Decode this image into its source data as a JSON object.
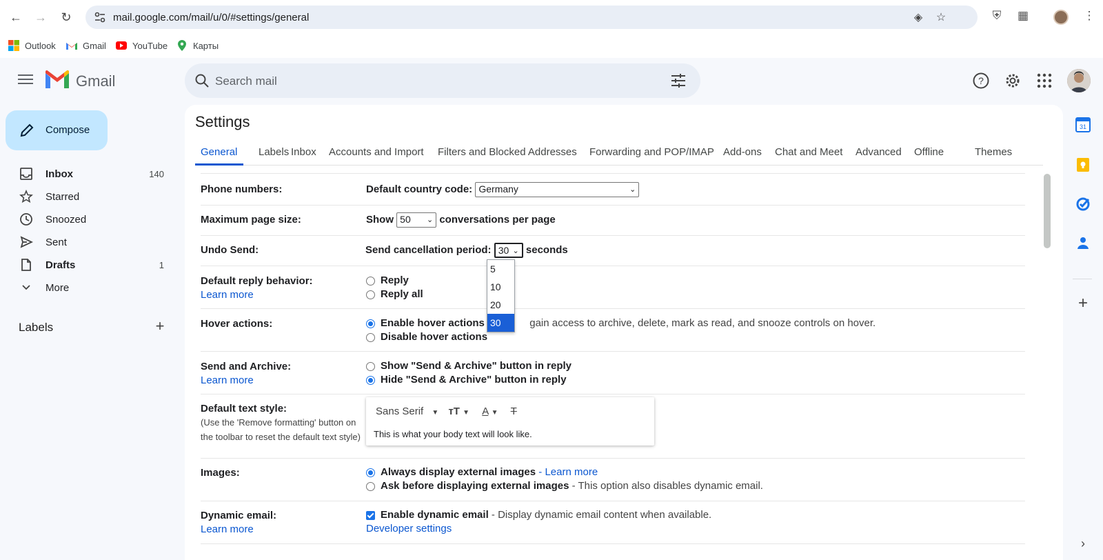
{
  "browser": {
    "url": "mail.google.com/mail/u/0/#settings/general",
    "bookmarks": [
      {
        "label": "Outlook"
      },
      {
        "label": "Gmail"
      },
      {
        "label": "YouTube"
      },
      {
        "label": "Карты"
      }
    ]
  },
  "header": {
    "app_name": "Gmail",
    "search_placeholder": "Search mail"
  },
  "nav": {
    "compose_label": "Compose",
    "items": [
      {
        "label": "Inbox",
        "count": "140",
        "icon": "inbox-icon"
      },
      {
        "label": "Starred",
        "count": "",
        "icon": "star-icon"
      },
      {
        "label": "Snoozed",
        "count": "",
        "icon": "clock-icon"
      },
      {
        "label": "Sent",
        "count": "",
        "icon": "send-icon"
      },
      {
        "label": "Drafts",
        "count": "1",
        "icon": "draft-icon"
      },
      {
        "label": "More",
        "count": "",
        "icon": "chevron-down-icon"
      }
    ],
    "labels_header": "Labels"
  },
  "settings": {
    "title": "Settings",
    "tabs": [
      "General",
      "Labels",
      "Inbox",
      "Accounts and Import",
      "Filters and Blocked Addresses",
      "Forwarding and POP/IMAP",
      "Add-ons",
      "Chat and Meet",
      "Advanced",
      "Offline",
      "Themes"
    ],
    "active_tab": "General",
    "phone": {
      "label": "Phone numbers:",
      "prefix": "Default country code:",
      "value": "Germany"
    },
    "page_size": {
      "label": "Maximum page size:",
      "prefix": "Show",
      "value": "50",
      "suffix": "conversations per page"
    },
    "undo_send": {
      "label": "Undo Send:",
      "prefix": "Send cancellation period:",
      "value": "30",
      "suffix": "seconds",
      "options": [
        "5",
        "10",
        "20",
        "30"
      ],
      "selected": "30"
    },
    "reply": {
      "label": "Default reply behavior:",
      "learn_more": "Learn more",
      "options": [
        "Reply",
        "Reply all"
      ]
    },
    "hover": {
      "label": "Hover actions:",
      "enable": "Enable hover actions",
      "enable_desc": "gain access to archive, delete, mark as read, and snooze controls on hover.",
      "disable": "Disable hover actions"
    },
    "send_archive": {
      "label": "Send and Archive:",
      "learn_more": "Learn more",
      "show": "Show \"Send & Archive\" button in reply",
      "hide": "Hide \"Send & Archive\" button in reply"
    },
    "text_style": {
      "label": "Default text style:",
      "note_line1": "(Use the 'Remove formatting' button on",
      "note_line2": "the toolbar to reset the default text style)",
      "font": "Sans Serif",
      "sample": "This is what your body text will look like."
    },
    "images": {
      "label": "Images:",
      "always": "Always display external images",
      "always_link": "Learn more",
      "ask": "Ask before displaying external images",
      "ask_desc": "- This option also disables dynamic email."
    },
    "dynamic": {
      "label": "Dynamic email:",
      "learn_more": "Learn more",
      "enable": "Enable dynamic email",
      "enable_desc": "- Display dynamic email content when available.",
      "dev_link": "Developer settings"
    }
  },
  "colors": {
    "accent": "#0b57d0",
    "compose_bg": "#c2e7ff",
    "page_bg": "#f6f8fc"
  }
}
